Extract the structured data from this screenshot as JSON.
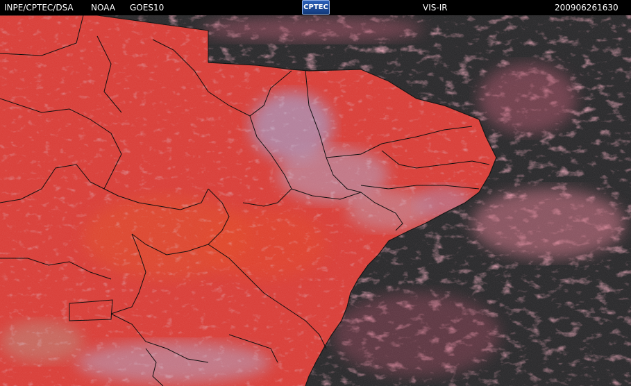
{
  "header": {
    "institution": "INPE/CPTEC/DSA",
    "agency": "NOAA",
    "satellite": "GOES10",
    "logo_text": "CPTEC",
    "channel": "VIS-IR",
    "timestamp": "200906261630"
  },
  "colors": {
    "land": "#d9403a",
    "ocean": "#2b2b2d",
    "clouds": "#c9c0d8",
    "cloud_edges": "#e36a80",
    "borders": "#0a0a0a",
    "header_bg": "#000000",
    "header_text": "#ffffff"
  },
  "icons": {
    "logo": "cptec-logo"
  }
}
